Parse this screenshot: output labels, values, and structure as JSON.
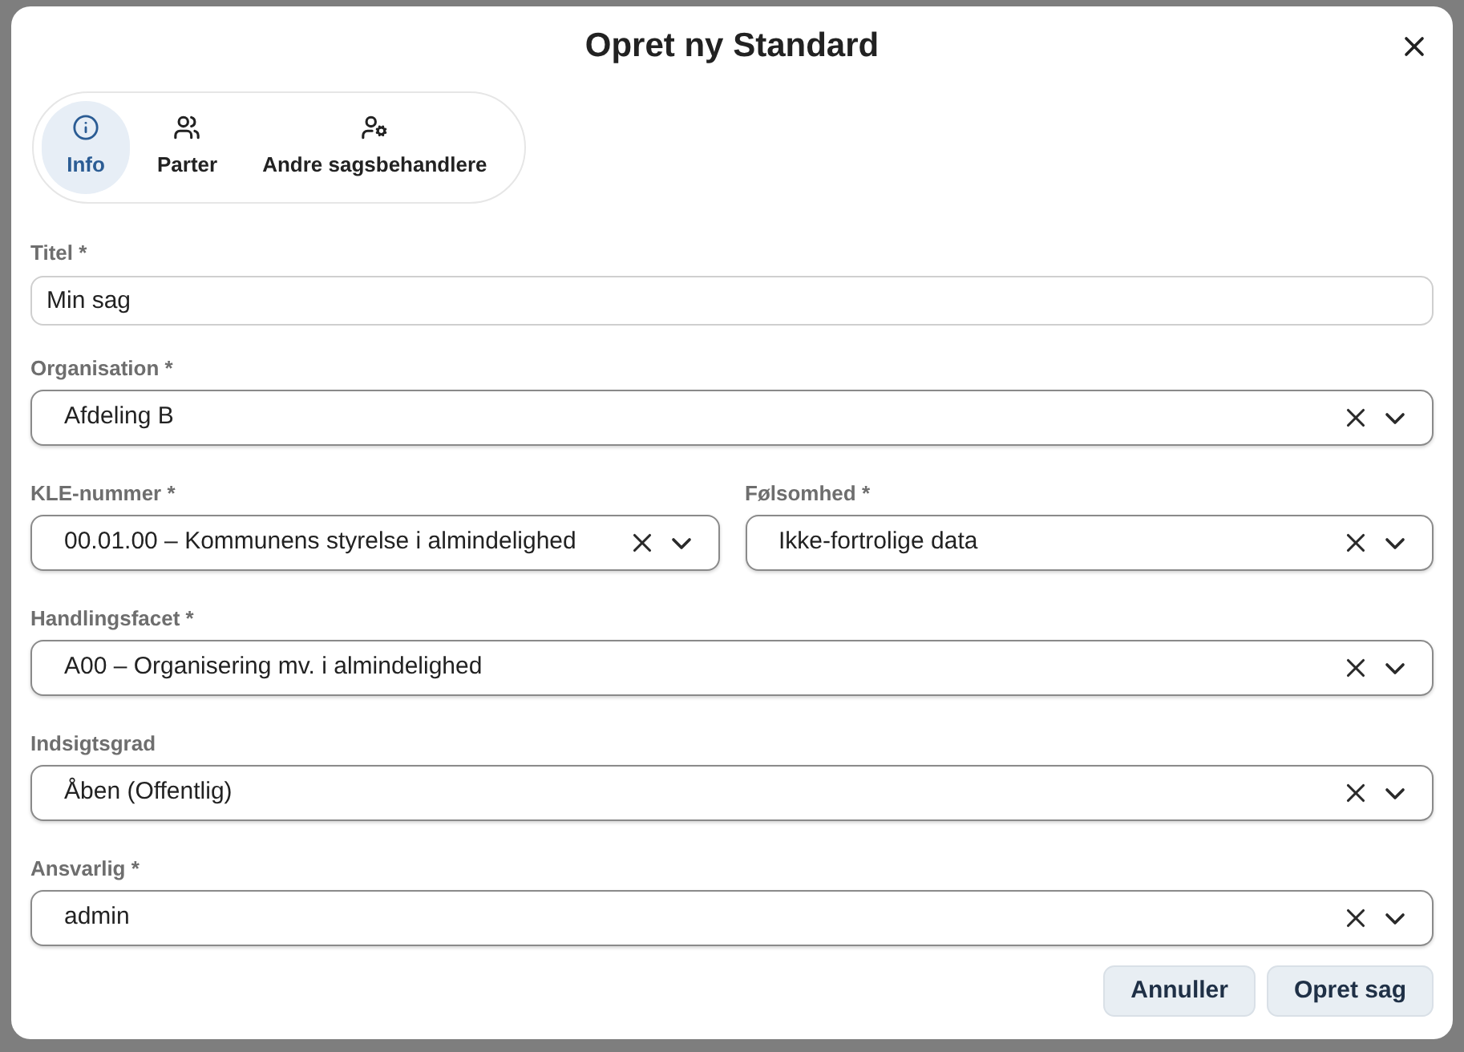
{
  "dialog": {
    "title": "Opret ny Standard"
  },
  "tabs": [
    {
      "label": "Info",
      "selected": true
    },
    {
      "label": "Parter",
      "selected": false
    },
    {
      "label": "Andre sagsbehandlere",
      "selected": false
    }
  ],
  "form": {
    "rows": [
      {
        "fields": [
          {
            "kind": "text",
            "label": "Titel *",
            "value": "Min sag"
          }
        ]
      },
      {
        "fields": [
          {
            "kind": "select",
            "label": "Organisation *",
            "value": "Afdeling B"
          }
        ]
      },
      {
        "fields": [
          {
            "kind": "select",
            "label": "KLE-nummer *",
            "value": "00.01.00 – Kommunens styrelse i almindelighed"
          },
          {
            "kind": "select",
            "label": "Følsomhed *",
            "value": "Ikke-fortrolige data"
          }
        ]
      },
      {
        "fields": [
          {
            "kind": "select",
            "label": "Handlingsfacet *",
            "value": "A00 – Organisering mv. i almindelighed"
          }
        ]
      },
      {
        "fields": [
          {
            "kind": "select",
            "label": "Indsigtsgrad",
            "value": "Åben (Offentlig)"
          }
        ]
      },
      {
        "fields": [
          {
            "kind": "select",
            "label": "Ansvarlig *",
            "value": "admin"
          }
        ]
      }
    ]
  },
  "buttons": [
    "Annuller",
    "Opret sag"
  ]
}
